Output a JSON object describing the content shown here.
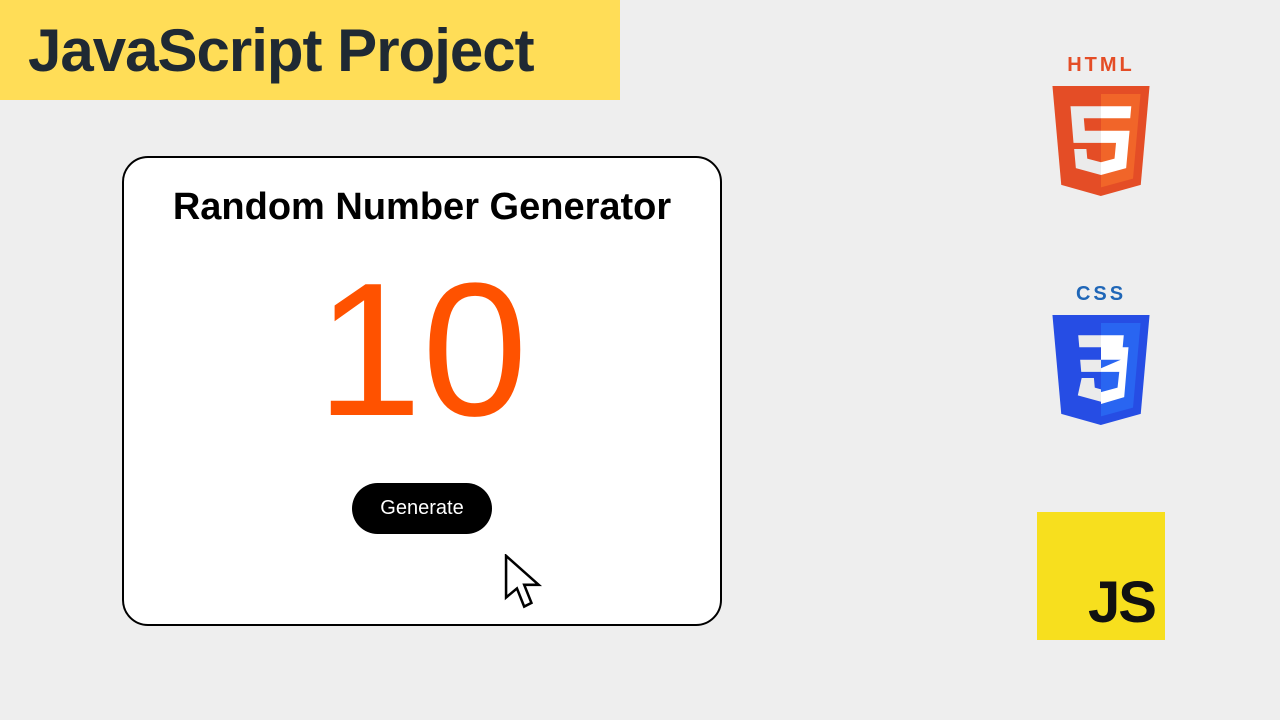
{
  "header": {
    "title": "JavaScript Project"
  },
  "card": {
    "title": "Random Number Generator",
    "value": "10",
    "button_label": "Generate"
  },
  "logos": {
    "html_label": "HTML",
    "css_label": "CSS",
    "js_label": "JS"
  },
  "colors": {
    "header_bg": "#ffdd57",
    "number": "#ff5200",
    "html_brand": "#e44d26",
    "css_brand": "#264de4",
    "js_brand": "#f7df1e"
  }
}
